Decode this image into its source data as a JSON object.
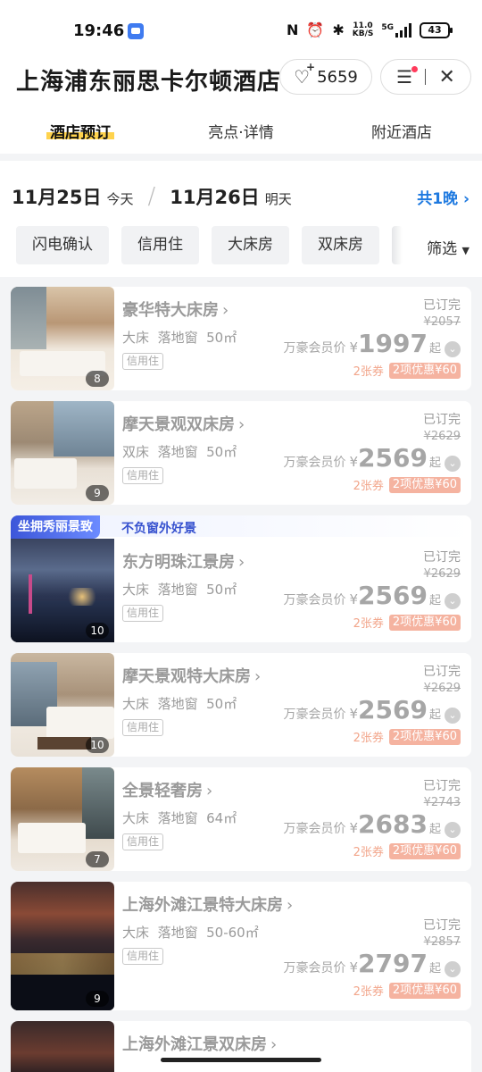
{
  "status_bar": {
    "time": "19:46",
    "net_speed": "11.0",
    "net_unit": "KB/S",
    "signal": "5G",
    "battery": "43"
  },
  "header": {
    "title": "上海浦东丽思卡尔顿酒店",
    "favorites_count": "5659"
  },
  "tabs": [
    {
      "label": "酒店预订",
      "active": true
    },
    {
      "label": "亮点·详情",
      "active": false
    },
    {
      "label": "附近酒店",
      "active": false
    }
  ],
  "dates": {
    "checkin": "11月25日",
    "checkin_label": "今天",
    "checkout": "11月26日",
    "checkout_label": "明天",
    "nights": "共1晚"
  },
  "filters": [
    "闪电确认",
    "信用住",
    "大床房",
    "双床房"
  ],
  "filter_button": "筛选",
  "rooms": [
    {
      "name": "豪华特大床房",
      "bed": "大床",
      "window": "落地窗",
      "area": "50㎡",
      "badge": "信用住",
      "status": "已订完",
      "orig_price": "¥2057",
      "member_label": "万豪会员价",
      "currency": "¥",
      "price": "1997",
      "suffix": "起",
      "coupons": "2张券",
      "discount": "2项优惠¥60",
      "photo_count": "8",
      "image": "bedroom-warm"
    },
    {
      "name": "摩天景观双床房",
      "bed": "双床",
      "window": "落地窗",
      "area": "50㎡",
      "badge": "信用住",
      "status": "已订完",
      "orig_price": "¥2629",
      "member_label": "万豪会员价",
      "currency": "¥",
      "price": "2569",
      "suffix": "起",
      "coupons": "2张券",
      "discount": "2项优惠¥60",
      "photo_count": "9",
      "image": "twin-city"
    },
    {
      "name": "东方明珠江景房",
      "bed": "大床",
      "window": "落地窗",
      "area": "50㎡",
      "badge": "信用住",
      "status": "已订完",
      "orig_price": "¥2629",
      "member_label": "万豪会员价",
      "currency": "¥",
      "price": "2569",
      "suffix": "起",
      "coupons": "2张券",
      "discount": "2项优惠¥60",
      "photo_count": "10",
      "image": "night-river",
      "promo_tag": "坐拥秀丽景致",
      "promo_text": "不负窗外好景"
    },
    {
      "name": "摩天景观特大床房",
      "bed": "大床",
      "window": "落地窗",
      "area": "50㎡",
      "badge": "信用住",
      "status": "已订完",
      "orig_price": "¥2629",
      "member_label": "万豪会员价",
      "currency": "¥",
      "price": "2569",
      "suffix": "起",
      "coupons": "2张券",
      "discount": "2项优惠¥60",
      "photo_count": "10",
      "image": "king-city"
    },
    {
      "name": "全景轻奢房",
      "bed": "大床",
      "window": "落地窗",
      "area": "64㎡",
      "badge": "信用住",
      "status": "已订完",
      "orig_price": "¥2743",
      "member_label": "万豪会员价",
      "currency": "¥",
      "price": "2683",
      "suffix": "起",
      "coupons": "2张券",
      "discount": "2项优惠¥60",
      "photo_count": "7",
      "image": "panorama"
    },
    {
      "name": "上海外滩江景特大床房",
      "bed": "大床",
      "window": "落地窗",
      "area": "50-60㎡",
      "badge": "信用住",
      "status": "已订完",
      "orig_price": "¥2857",
      "member_label": "万豪会员价",
      "currency": "¥",
      "price": "2797",
      "suffix": "起",
      "coupons": "2张券",
      "discount": "2项优惠¥60",
      "photo_count": "9",
      "image": "bund-night"
    },
    {
      "name": "上海外滩江景双床房",
      "image": "bund-dusk"
    }
  ]
}
